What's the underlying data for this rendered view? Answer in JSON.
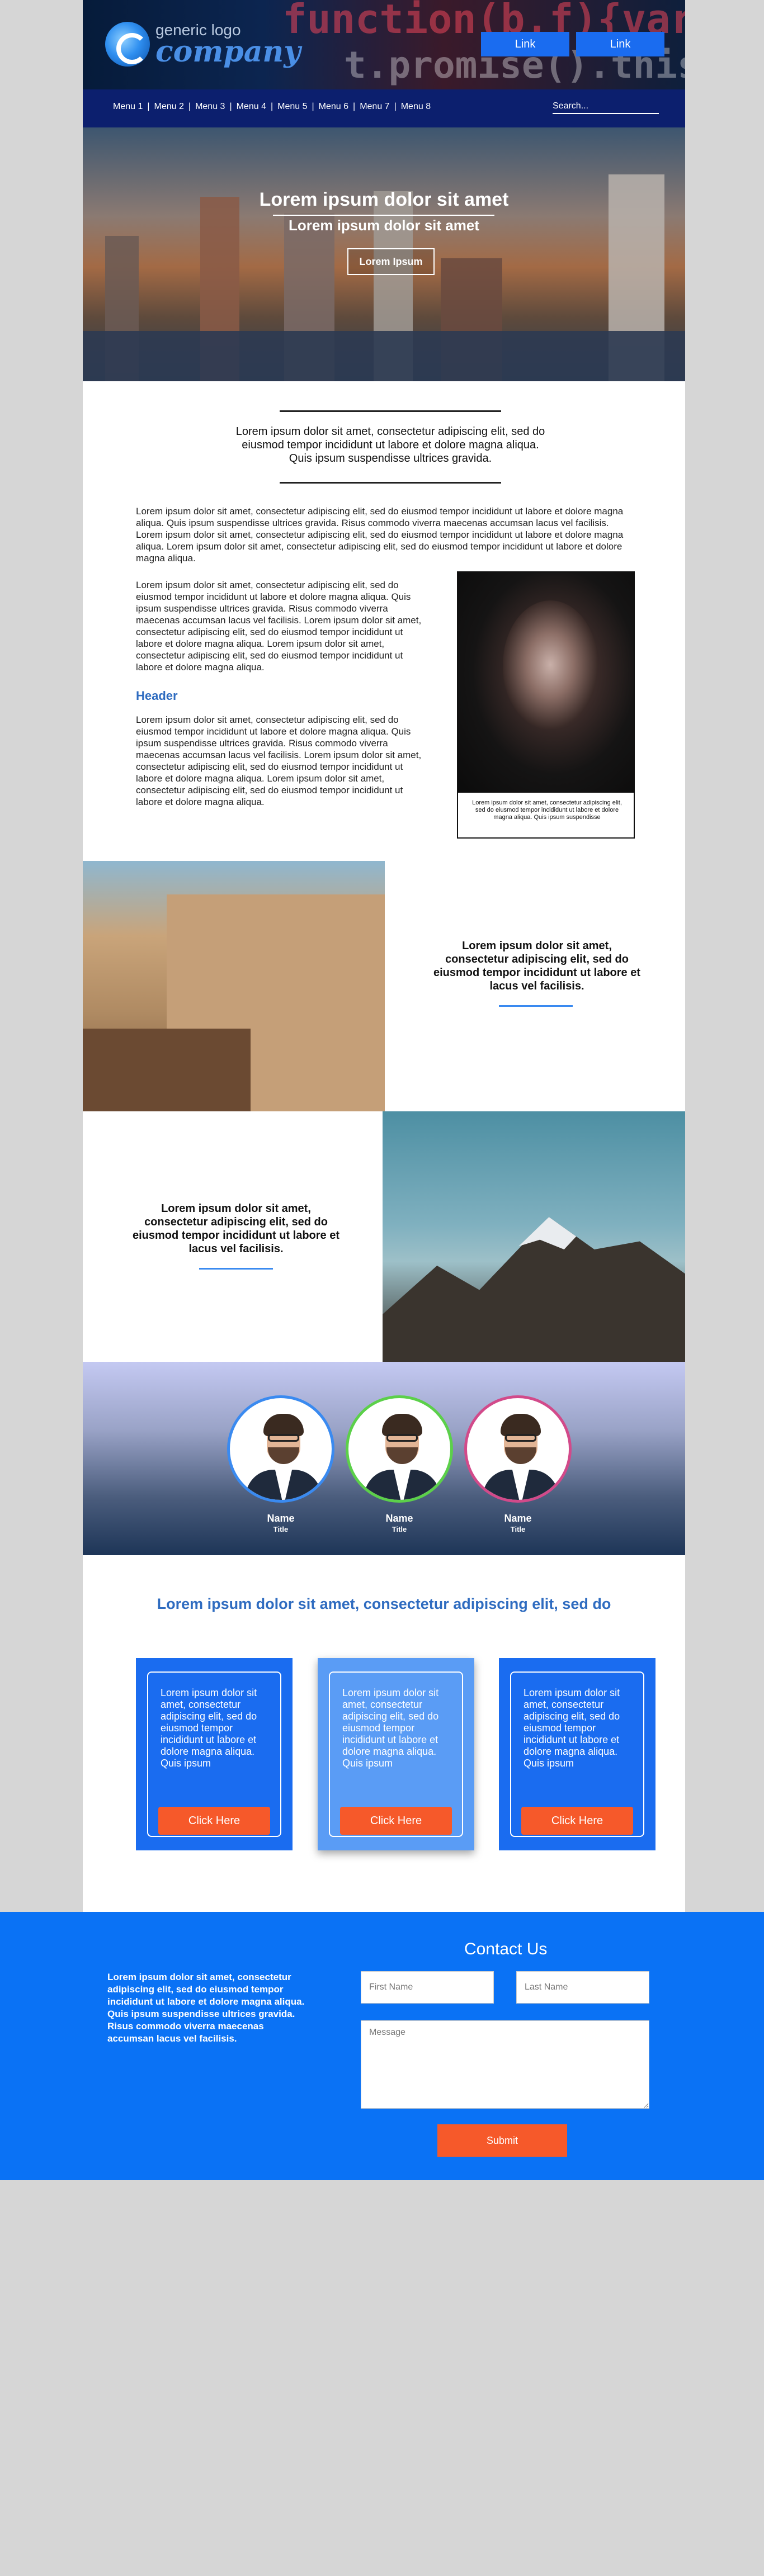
{
  "header": {
    "logo": {
      "small": "generic logo",
      "big": "company"
    },
    "code_background": {
      "line1": "function(b,f){var g",
      "line2": "t.promise().this"
    },
    "links": [
      "Link",
      "Link"
    ]
  },
  "nav": {
    "items": [
      "Menu 1",
      "Menu 2",
      "Menu 3",
      "Menu 4",
      "Menu 5",
      "Menu 6",
      "Menu 7",
      "Menu 8"
    ],
    "separator": "|",
    "search_placeholder": "Search..."
  },
  "hero": {
    "title": "Lorem ipsum dolor sit amet",
    "subtitle": "Lorem ipsum dolor sit amet",
    "button": "Lorem Ipsum"
  },
  "intro": "Lorem ipsum dolor sit amet, consectetur adipiscing elit, sed do eiusmod tempor incididunt ut labore et dolore magna aliqua. Quis ipsum suspendisse ultrices gravida.",
  "article": {
    "p1": "Lorem ipsum dolor sit amet, consectetur adipiscing elit, sed do eiusmod tempor incididunt ut labore et dolore magna aliqua. Quis ipsum suspendisse ultrices gravida. Risus commodo viverra maecenas accumsan lacus vel facilisis. Lorem ipsum dolor sit amet, consectetur adipiscing elit, sed do eiusmod tempor incididunt ut labore et dolore magna aliqua. Lorem ipsum dolor sit amet, consectetur adipiscing elit, sed do eiusmod tempor incididunt ut labore et dolore magna aliqua.",
    "p2": "Lorem ipsum dolor sit amet, consectetur adipiscing elit, sed do eiusmod tempor incididunt ut labore et dolore magna aliqua. Quis ipsum suspendisse ultrices gravida. Risus commodo viverra maecenas accumsan lacus vel facilisis. Lorem ipsum dolor sit amet, consectetur adipiscing elit, sed do eiusmod tempor incididunt ut labore et dolore magna aliqua. Lorem ipsum dolor sit amet, consectetur adipiscing elit, sed do eiusmod tempor incididunt ut labore et dolore magna aliqua.",
    "header": "Header",
    "p3": "Lorem ipsum dolor sit amet, consectetur adipiscing elit, sed do eiusmod tempor incididunt ut labore et dolore magna aliqua. Quis ipsum suspendisse ultrices gravida. Risus commodo viverra maecenas accumsan lacus vel facilisis. Lorem ipsum dolor sit amet, consectetur adipiscing elit, sed do eiusmod tempor incididunt ut labore et dolore magna aliqua. Lorem ipsum dolor sit amet, consectetur adipiscing elit, sed do eiusmod tempor incididunt ut labore et dolore magna aliqua.",
    "image_caption": "Lorem ipsum dolor sit amet, consectetur adipiscing elit, sed do eiusmod tempor incididunt ut labore et dolore magna aliqua. Quis ipsum suspendisse"
  },
  "features": [
    {
      "text": "Lorem ipsum dolor sit amet, consectetur adipiscing elit, sed do eiusmod tempor incididunt ut labore et lacus vel facilisis."
    },
    {
      "text": "Lorem ipsum dolor sit amet, consectetur adipiscing elit, sed do eiusmod tempor incididunt ut labore et lacus vel facilisis."
    }
  ],
  "team": [
    {
      "name": "Name",
      "title": "Title",
      "ring_color": "#3a8af0"
    },
    {
      "name": "Name",
      "title": "Title",
      "ring_color": "#5cd04a"
    },
    {
      "name": "Name",
      "title": "Title",
      "ring_color": "#d24a8a"
    }
  ],
  "cards_section": {
    "title": "Lorem ipsum dolor sit amet, consectetur adipiscing elit, sed do",
    "cards": [
      {
        "text": "Lorem ipsum dolor sit amet, consectetur adipiscing elit, sed do eiusmod tempor incididunt ut labore et dolore magna aliqua. Quis ipsum",
        "button": "Click Here"
      },
      {
        "text": "Lorem ipsum dolor sit amet, consectetur adipiscing elit, sed do eiusmod tempor incididunt ut labore et dolore magna aliqua. Quis ipsum",
        "button": "Click Here"
      },
      {
        "text": "Lorem ipsum dolor sit amet, consectetur adipiscing elit, sed do eiusmod tempor incididunt ut labore et dolore magna aliqua. Quis ipsum",
        "button": "Click Here"
      }
    ]
  },
  "contact": {
    "title": "Contact Us",
    "text": "Lorem ipsum dolor sit amet, consectetur adipiscing elit, sed do eiusmod tempor incididunt ut labore et dolore magna aliqua. Quis ipsum suspendisse ultrices gravida. Risus commodo viverra maecenas accumsan lacus vel facilisis.",
    "first_name_placeholder": "First Name",
    "last_name_placeholder": "Last Name",
    "message_placeholder": "Message",
    "submit": "Submit"
  },
  "colors": {
    "brand_blue": "#1a6cf0",
    "nav_navy": "#0c1f6e",
    "accent_orange": "#f6592a",
    "header_blue_text": "#2f6cc0"
  }
}
